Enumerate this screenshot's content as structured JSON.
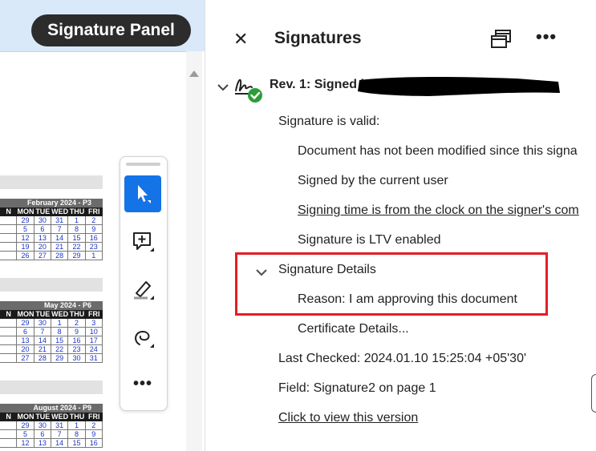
{
  "chip": {
    "label": "Signature Panel"
  },
  "calendars": [
    {
      "title": "February 2024 - P3",
      "headers": [
        "N",
        "MON",
        "TUE",
        "WED",
        "THU",
        "FRI"
      ],
      "rows": [
        [
          "",
          "29",
          "30",
          "31",
          "1",
          "2"
        ],
        [
          "",
          "5",
          "6",
          "7",
          "8",
          "9"
        ],
        [
          "",
          "12",
          "13",
          "14",
          "15",
          "16"
        ],
        [
          "",
          "19",
          "20",
          "21",
          "22",
          "23"
        ],
        [
          "",
          "26",
          "27",
          "28",
          "29",
          "1"
        ]
      ]
    },
    {
      "title": "May 2024 - P6",
      "headers": [
        "N",
        "MON",
        "TUE",
        "WED",
        "THU",
        "FRI"
      ],
      "rows": [
        [
          "",
          "29",
          "30",
          "1",
          "2",
          "3"
        ],
        [
          "",
          "6",
          "7",
          "8",
          "9",
          "10"
        ],
        [
          "",
          "13",
          "14",
          "15",
          "16",
          "17"
        ],
        [
          "",
          "20",
          "21",
          "22",
          "23",
          "24"
        ],
        [
          "",
          "27",
          "28",
          "29",
          "30",
          "31"
        ]
      ]
    },
    {
      "title": "August 2024 - P9",
      "headers": [
        "N",
        "MON",
        "TUE",
        "WED",
        "THU",
        "FRI"
      ],
      "rows": [
        [
          "",
          "29",
          "30",
          "31",
          "1",
          "2"
        ],
        [
          "",
          "5",
          "6",
          "7",
          "8",
          "9"
        ],
        [
          "",
          "12",
          "13",
          "14",
          "15",
          "16"
        ]
      ]
    }
  ],
  "panel": {
    "title": "Signatures",
    "revision": "Rev. 1: Signed by",
    "valid": "Signature is valid:",
    "not_modified": "Document has not been modified since this signa",
    "signed_by": "Signed by the current user",
    "signing_time": "Signing time is from the clock on the signer's com",
    "ltv": "Signature is LTV enabled",
    "details": "Signature Details",
    "reason": "Reason: I am approving this document",
    "certificate": "Certificate Details...",
    "last_checked": "Last Checked: 2024.01.10 15:25:04 +05'30'",
    "field": "Field: Signature2 on page 1",
    "view_version": "Click to view this version"
  },
  "colors": {
    "accent": "#1473e6",
    "highlight": "#e41e25",
    "valid": "#2d9d3a",
    "chip_bg": "#2c2c2c",
    "top_bg": "#d9e9f9"
  },
  "icons": {
    "close": "close-icon",
    "windows": "windows-icon",
    "more": "more-icon",
    "select": "select-tool-icon",
    "comment": "add-comment-icon",
    "highlighter": "highlighter-icon",
    "lasso": "lasso-icon",
    "signature": "signature-valid-icon"
  }
}
